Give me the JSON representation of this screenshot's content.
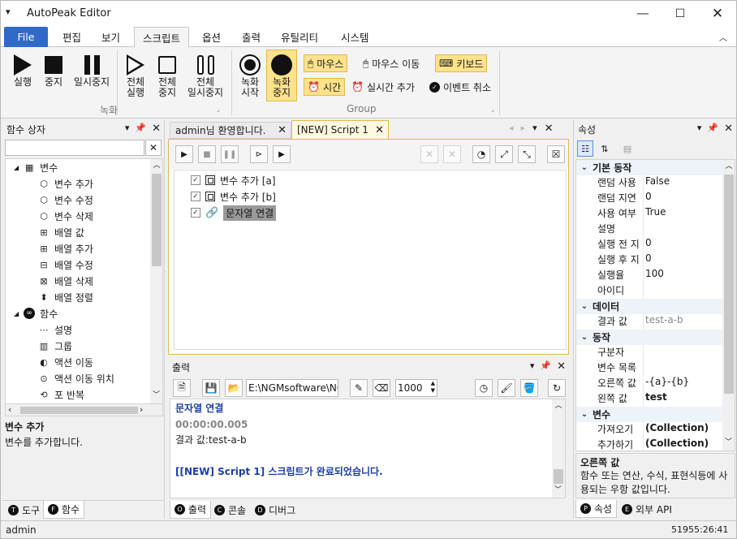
{
  "app": {
    "title": "AutoPeak Editor"
  },
  "menu_tabs": [
    "File",
    "편집",
    "보기",
    "스크립트",
    "옵션",
    "출력",
    "유틸리티",
    "시스템"
  ],
  "ribbon": {
    "play": {
      "label": [
        "실행"
      ]
    },
    "stop": {
      "label": [
        "중지"
      ]
    },
    "pause": {
      "label": [
        "일시중지"
      ]
    },
    "run_all": {
      "label": [
        "전체",
        "실행"
      ]
    },
    "stop_all": {
      "label": [
        "전체",
        "중지"
      ]
    },
    "pause_all": {
      "label": [
        "전체",
        "일시중지"
      ]
    },
    "rec_start": {
      "label": [
        "녹화",
        "시작"
      ]
    },
    "rec_stop": {
      "label": [
        "녹화",
        "중지"
      ]
    },
    "mouse": "마우스",
    "mouse_move": "마우스 이동",
    "keyboard": "키보드",
    "time": "시간",
    "realtime_add": "실시간 추가",
    "event_cancel": "이벤트 취소",
    "group_record": "녹화",
    "group_group": "Group"
  },
  "left_panel": {
    "title": "함수 상자",
    "tree": [
      {
        "label": "변수",
        "level": 0,
        "icon": "variables-icon"
      },
      {
        "label": "변수 추가",
        "level": 1,
        "icon": "cube-icon"
      },
      {
        "label": "변수 수정",
        "level": 1,
        "icon": "cube-icon"
      },
      {
        "label": "변수 삭제",
        "level": 1,
        "icon": "cube-icon"
      },
      {
        "label": "배열 값",
        "level": 1,
        "icon": "array-icon"
      },
      {
        "label": "배열 추가",
        "level": 1,
        "icon": "array-add-icon"
      },
      {
        "label": "배열 수정",
        "level": 1,
        "icon": "array-edit-icon"
      },
      {
        "label": "배열 삭제",
        "level": 1,
        "icon": "array-delete-icon"
      },
      {
        "label": "배열 정렬",
        "level": 1,
        "icon": "sort-icon"
      },
      {
        "label": "함수",
        "level": 0,
        "icon": "function-icon"
      },
      {
        "label": "설명",
        "level": 1,
        "icon": "comment-icon"
      },
      {
        "label": "그룹",
        "level": 1,
        "icon": "group-icon"
      },
      {
        "label": "액션 이동",
        "level": 1,
        "icon": "action-move-icon"
      },
      {
        "label": "액션 이동 위치",
        "level": 1,
        "icon": "target-icon"
      },
      {
        "label": "포 반복",
        "level": 1,
        "icon": "loop-icon"
      }
    ],
    "desc_title": "변수 추가",
    "desc_body": "변수를 추가합니다.",
    "tabs": [
      {
        "label": "도구",
        "key": "T"
      },
      {
        "label": "함수",
        "key": "F"
      }
    ]
  },
  "doc_tabs": [
    {
      "label": "admin님 환영합니다."
    },
    {
      "label": "[NEW] Script 1"
    }
  ],
  "script_items": [
    {
      "label": "변수 추가 [a]",
      "checked": "✓"
    },
    {
      "label": "변수 추가 [b]",
      "checked": "✓"
    },
    {
      "label": "문자열 연결",
      "checked": "✓"
    }
  ],
  "output": {
    "title": "출력",
    "path": "E:\\NGMsoftware\\NG",
    "interval": "1000",
    "lines": [
      {
        "text": "문자열 연결",
        "color": "#1d3fa6",
        "bold": true
      },
      {
        "text": "00:00:00.005",
        "color": "#888888",
        "bold": true
      },
      {
        "text": "결과 값:test-a-b",
        "color": "#222222",
        "bold": false
      },
      {
        "text": "",
        "color": "#222222",
        "bold": false
      },
      {
        "text": "[[NEW] Script 1] 스크립트가 완료되었습니다.",
        "color": "#1d3fa6",
        "bold": true
      }
    ],
    "tabs": [
      {
        "label": "출력",
        "key": "O"
      },
      {
        "label": "콘솔",
        "key": "C"
      },
      {
        "label": "디버그",
        "key": "D"
      }
    ]
  },
  "properties": {
    "title": "속성",
    "rows": [
      {
        "type": "cat",
        "label": "기본 동작"
      },
      {
        "type": "row",
        "k": "랜덤 사용",
        "v": "False"
      },
      {
        "type": "row",
        "k": "랜덤 지연",
        "v": "0"
      },
      {
        "type": "row",
        "k": "사용 여부",
        "v": "True"
      },
      {
        "type": "row",
        "k": "설명",
        "v": ""
      },
      {
        "type": "row",
        "k": "실행 전 지",
        "v": "0"
      },
      {
        "type": "row",
        "k": "실행 후 지",
        "v": "0"
      },
      {
        "type": "row",
        "k": "실행율",
        "v": "100"
      },
      {
        "type": "row",
        "k": "아이디",
        "v": ""
      },
      {
        "type": "cat",
        "label": "데이터"
      },
      {
        "type": "row",
        "k": "결과 값",
        "v": "test-a-b",
        "dim": true
      },
      {
        "type": "cat",
        "label": "동작"
      },
      {
        "type": "row",
        "k": "구분자",
        "v": ""
      },
      {
        "type": "row",
        "k": "변수 목록",
        "v": ""
      },
      {
        "type": "row",
        "k": "오른쪽 값",
        "v": "-{a}-{b}"
      },
      {
        "type": "row",
        "k": "왼쪽 값",
        "v": "test",
        "bold": true
      },
      {
        "type": "cat",
        "label": "변수"
      },
      {
        "type": "row",
        "k": "가져오기",
        "v": "(Collection)",
        "bold": true
      },
      {
        "type": "row",
        "k": "추가하기",
        "v": "(Collection)",
        "bold": true
      }
    ],
    "desc_title": "오른쪽 값",
    "desc_body": "함수 또는 연산, 수식, 표현식등에 사용되는 우항 값입니다.",
    "tabs": [
      {
        "label": "속성",
        "key": "P"
      },
      {
        "label": "외부 API",
        "key": "E"
      }
    ]
  },
  "status": {
    "user": "admin",
    "time": "51955:26:41"
  }
}
